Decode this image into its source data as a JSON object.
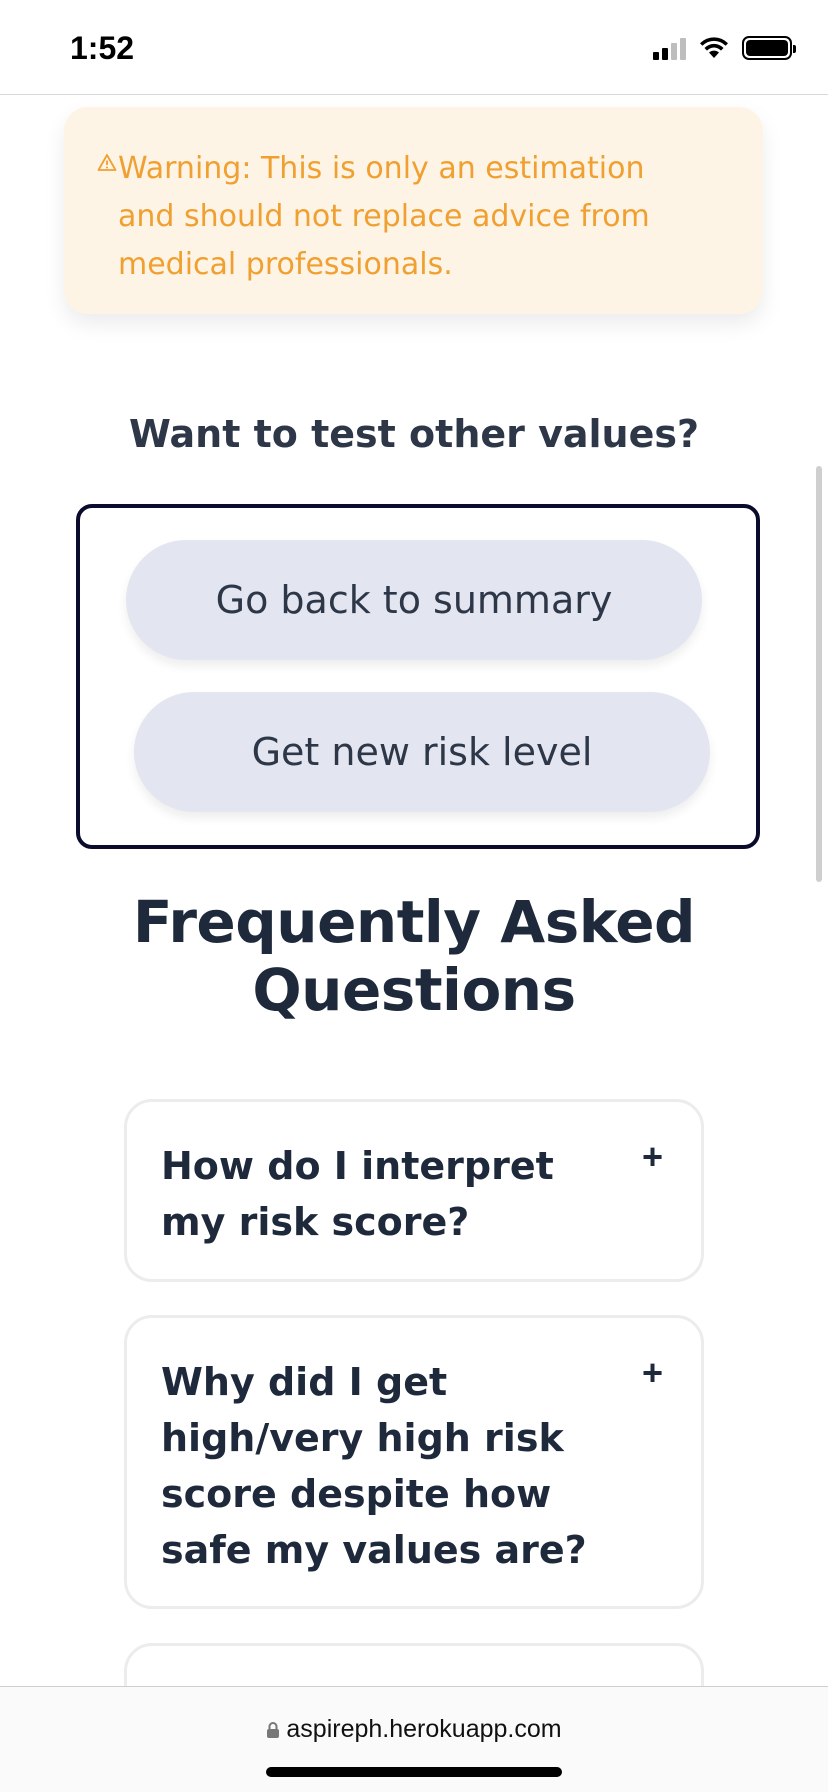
{
  "status_bar": {
    "time": "1:52",
    "icons": [
      "signal-icon",
      "wifi-icon",
      "battery-icon"
    ]
  },
  "warning": {
    "icon": "warning-triangle-icon",
    "text": "Warning: This is only an estimation and should not replace advice from medical professionals.",
    "color": "#f0a030",
    "background": "#fdf4e6"
  },
  "test_section": {
    "heading": "Want to test other values?",
    "buttons": {
      "summary": "Go back to summary",
      "new_risk": "Get new risk level"
    }
  },
  "faq": {
    "heading": "Frequently Asked Questions",
    "items": [
      {
        "question": "How do I interpret my risk score?",
        "toggle": "+"
      },
      {
        "question": "Why did I get high/very high risk score despite how safe my values are?",
        "toggle": "+"
      },
      {
        "question": "",
        "toggle": ""
      }
    ]
  },
  "browser": {
    "url": "aspireph.herokuapp.com",
    "lock_icon": "lock-icon"
  }
}
